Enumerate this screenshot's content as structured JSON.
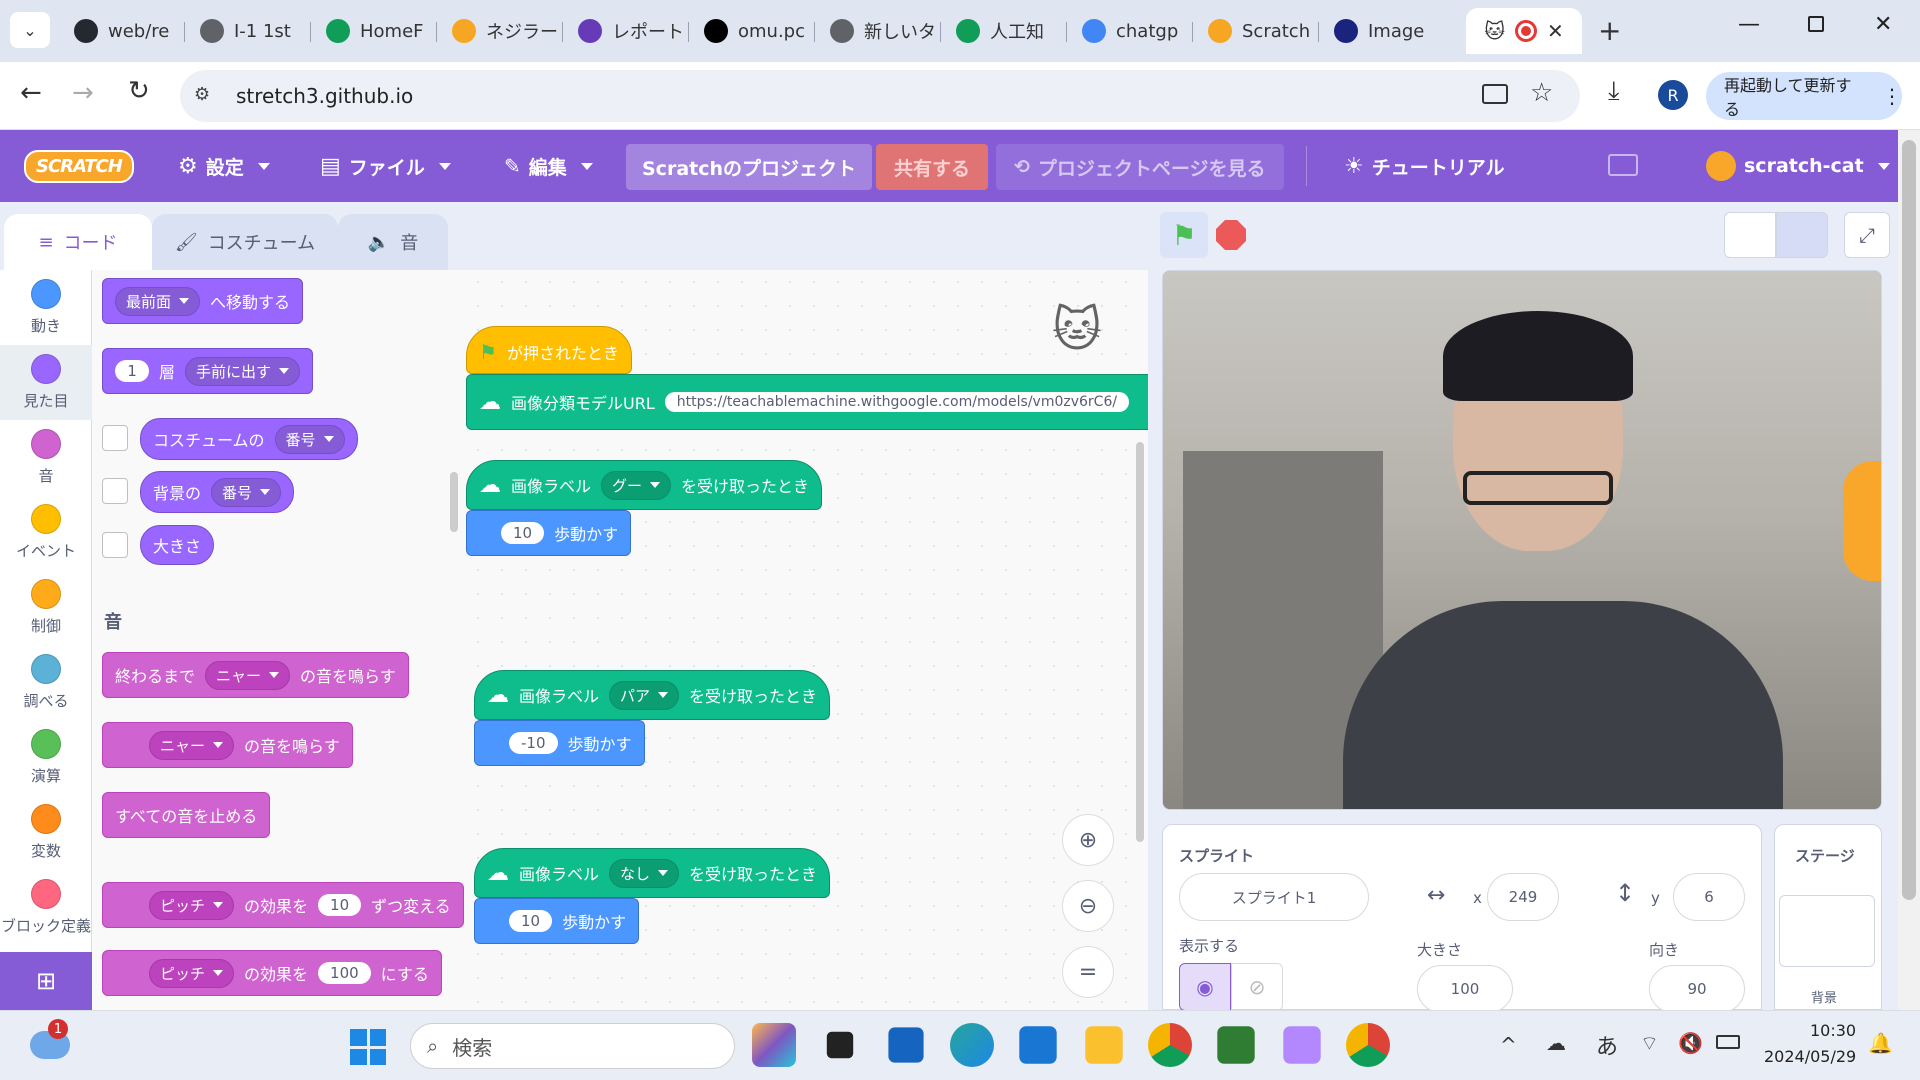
{
  "browser": {
    "tabs": [
      {
        "label": "web/re",
        "icon": "github-icon",
        "color": "#24292f"
      },
      {
        "label": "I-1 1st",
        "icon": "globe-icon",
        "color": "#5f6368"
      },
      {
        "label": "HomeF",
        "icon": "google-drive-icon",
        "color": "#0f9d58"
      },
      {
        "label": "ネジラー",
        "icon": "scratch-tab-icon",
        "color": "#f6a623"
      },
      {
        "label": "レポート",
        "icon": "forms-icon",
        "color": "#673ab7"
      },
      {
        "label": "omu.pc",
        "icon": "triangle-icon",
        "color": "#000000"
      },
      {
        "label": "新しいタ",
        "icon": "chrome-icon",
        "color": "#5f6368"
      },
      {
        "label": "人工知",
        "icon": "google-drive-icon",
        "color": "#0f9d58"
      },
      {
        "label": "chatgp",
        "icon": "google-icon",
        "color": "#4285f4"
      },
      {
        "label": "Scratch",
        "icon": "scratch-tab-icon",
        "color": "#f6a623"
      },
      {
        "label": "Image",
        "icon": "teachable-machine-icon",
        "color": "#1a237e"
      }
    ],
    "active_tab_icon": "scratch-cat-icon",
    "url": "stretch3.github.io",
    "update_button": "再起動して更新する",
    "profile_initial": "R"
  },
  "menu": {
    "logo": "SCRATCH",
    "settings": "設定",
    "file": "ファイル",
    "edit": "編集",
    "project_title": "Scratchのプロジェクト",
    "share": "共有する",
    "see_project_page": "プロジェクトページを見る",
    "tutorials": "チュートリアル",
    "username": "scratch-cat",
    "brand_color": "#855cd6",
    "share_color": "#e07474"
  },
  "editor_tabs": {
    "code": "コード",
    "costumes": "コスチューム",
    "sounds": "音"
  },
  "categories": [
    {
      "label": "動き",
      "color": "#4c97ff"
    },
    {
      "label": "見た目",
      "color": "#9966ff"
    },
    {
      "label": "音",
      "color": "#cf63cf"
    },
    {
      "label": "イベント",
      "color": "#ffbf00"
    },
    {
      "label": "制御",
      "color": "#ffab19"
    },
    {
      "label": "調べる",
      "color": "#5cb1d6"
    },
    {
      "label": "演算",
      "color": "#59c059"
    },
    {
      "label": "変数",
      "color": "#ff8c1a"
    },
    {
      "label": "ブロック定義",
      "color": "#ff6680"
    }
  ],
  "palette": {
    "go_to_front": {
      "menu": "最前面",
      "text": "へ移動する"
    },
    "go_layers": {
      "value": "1",
      "unit": "層",
      "menu": "手前に出す"
    },
    "costume_reporter": {
      "text": "コスチュームの",
      "menu": "番号"
    },
    "backdrop_reporter": {
      "text": "背景の",
      "menu": "番号"
    },
    "size_reporter": "大きさ",
    "sound_heading": "音",
    "play_until_done": {
      "prefix": "終わるまで",
      "menu": "ニャー",
      "suffix": "の音を鳴らす"
    },
    "start_sound": {
      "menu": "ニャー",
      "suffix": "の音を鳴らす"
    },
    "stop_all": "すべての音を止める",
    "change_effect": {
      "menu": "ピッチ",
      "mid": "の効果を",
      "value": "10",
      "suffix": "ずつ変える"
    },
    "set_effect": {
      "menu": "ピッチ",
      "mid": "の効果を",
      "value": "100",
      "suffix": "にする"
    }
  },
  "script": {
    "flag_hat": "が押されたとき",
    "model_url_label": "画像分類モデルURL",
    "model_url": "https://teachablemachine.withgoogle.com/models/vm0zv6rC6/",
    "label_hats": [
      {
        "prefix": "画像ラベル",
        "menu": "グー",
        "suffix": "を受け取ったとき",
        "move": "10",
        "move_label": "歩動かす"
      },
      {
        "prefix": "画像ラベル",
        "menu": "パア",
        "suffix": "を受け取ったとき",
        "move": "-10",
        "move_label": "歩動かす"
      },
      {
        "prefix": "画像ラベル",
        "menu": "なし",
        "suffix": "を受け取ったとき",
        "move": "10",
        "move_label": "歩動かす"
      }
    ]
  },
  "sprite_info": {
    "sprite_label": "スプライト",
    "name": "スプライト1",
    "x": "249",
    "y": "6",
    "show_label": "表示する",
    "size_label": "大きさ",
    "size": "100",
    "direction_label": "向き",
    "direction": "90",
    "x_label": "x",
    "y_label": "y"
  },
  "stage_info": {
    "label": "ステージ",
    "backdrop": "背景"
  },
  "taskbar": {
    "search_placeholder": "検索",
    "notification_count": "1",
    "time": "10:30",
    "date": "2024/05/29",
    "ime": "あ"
  }
}
